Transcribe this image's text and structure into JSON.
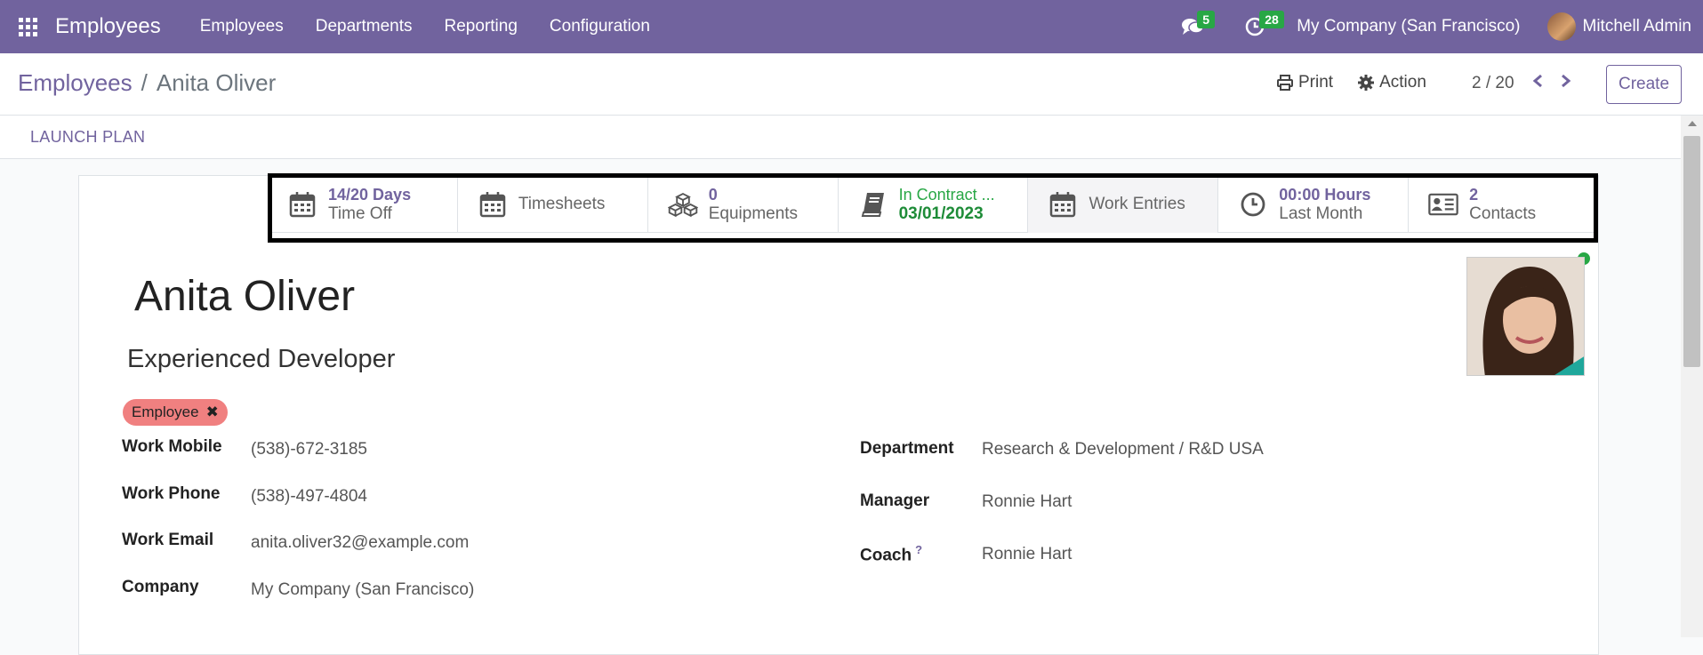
{
  "navbar": {
    "app_title": "Employees",
    "menu": [
      "Employees",
      "Departments",
      "Reporting",
      "Configuration"
    ],
    "messages_count": "5",
    "activities_count": "28",
    "company": "My Company (San Francisco)",
    "user": "Mitchell Admin",
    "color": "#71639e"
  },
  "breadcrumb": {
    "parent": "Employees",
    "separator": "/",
    "current": "Anita Oliver"
  },
  "actions": {
    "print": "Print",
    "action": "Action"
  },
  "pager": {
    "value": "2 / 20",
    "prev": "‹",
    "next": "›"
  },
  "create_label": "Create",
  "launch_plan": "LAUNCH PLAN",
  "stat_buttons": [
    {
      "icon": "calendar-icon",
      "value": "14/20 Days",
      "label": "Time Off"
    },
    {
      "icon": "calendar-icon",
      "label": "Timesheets"
    },
    {
      "icon": "cubes-icon",
      "value": "0",
      "label": "Equipments"
    },
    {
      "icon": "book-icon",
      "value": "In Contract ...",
      "label": "03/01/2023"
    },
    {
      "icon": "calendar-icon",
      "label": "Work Entries"
    },
    {
      "icon": "clock-icon",
      "value": "00:00 Hours",
      "label": "Last Month"
    },
    {
      "icon": "contact-card-icon",
      "value": "2",
      "label": "Contacts"
    }
  ],
  "employee": {
    "name": "Anita Oliver",
    "job_title": "Experienced Developer",
    "tag": "Employee",
    "tag_color": "#f08080"
  },
  "fields_left": [
    {
      "label": "Work Mobile",
      "value": "(538)-672-3185"
    },
    {
      "label": "Work Phone",
      "value": "(538)-497-4804"
    },
    {
      "label": "Work Email",
      "value": "anita.oliver32@example.com"
    },
    {
      "label": "Company",
      "value": "My Company (San Francisco)"
    }
  ],
  "fields_right": [
    {
      "label": "Department",
      "value": "Research & Development / R&D USA"
    },
    {
      "label": "Manager",
      "value": "Ronnie Hart"
    },
    {
      "label": "Coach",
      "help": "?",
      "value": "Ronnie Hart"
    }
  ]
}
